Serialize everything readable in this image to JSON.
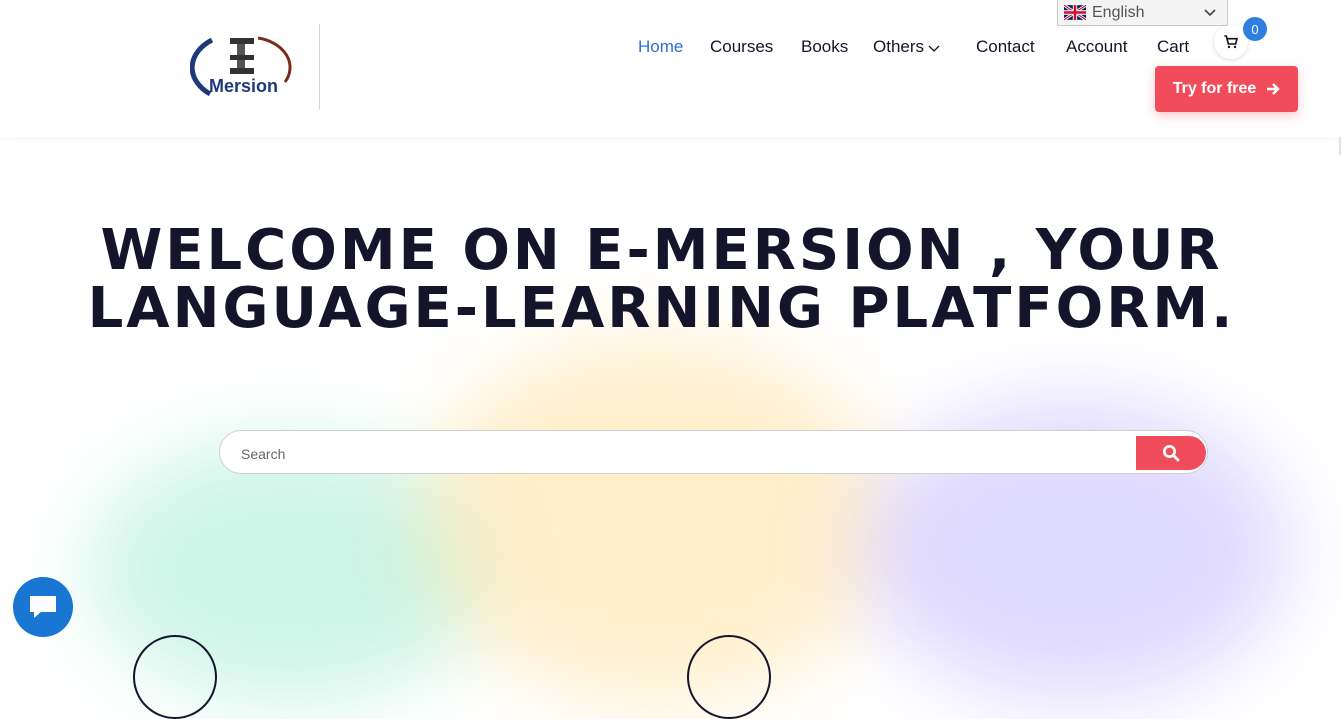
{
  "header": {
    "logo_text": "Mersion",
    "language": {
      "selected": "English",
      "flag_icon": "uk-flag-icon"
    },
    "nav": [
      {
        "label": "Home",
        "active": true
      },
      {
        "label": "Courses",
        "active": false
      },
      {
        "label": "Books",
        "active": false
      },
      {
        "label": "Others",
        "active": false,
        "has_dropdown": true
      },
      {
        "label": "Contact",
        "active": false
      },
      {
        "label": "Account",
        "active": false
      },
      {
        "label": "Cart",
        "active": false
      }
    ],
    "cart_count": "0",
    "cta_label": "Try for free"
  },
  "hero": {
    "title_line1": "WELCOME ON E-MERSION , YOUR",
    "title_line2": "LANGUAGE-LEARNING PLATFORM."
  },
  "search": {
    "placeholder": "Search"
  },
  "colors": {
    "accent": "#f04c5c",
    "nav_active": "#2f6fd6",
    "badge": "#2f7fe0",
    "chat": "#1976d2",
    "text": "#14142b"
  }
}
